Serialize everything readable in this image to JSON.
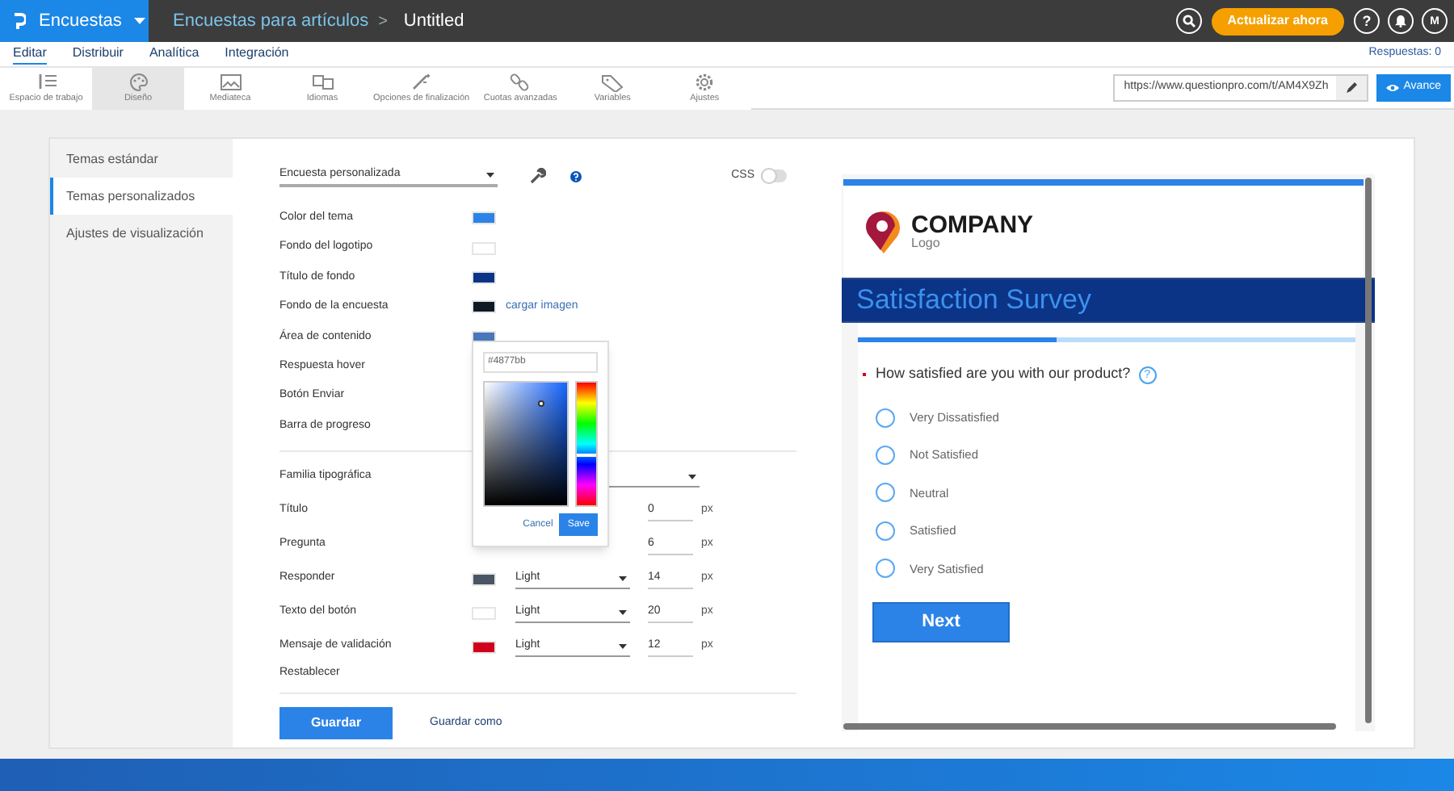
{
  "top_bar": {
    "app_menu": "Encuestas",
    "breadcrumb": {
      "parent": "Encuestas para artículos",
      "separator": ">",
      "current": "Untitled"
    },
    "upgrade_button": "Actualizar ahora",
    "help": "?",
    "avatar": "M"
  },
  "nav_tabs": [
    {
      "label": "Editar",
      "selected": true
    },
    {
      "label": "Distribuir",
      "selected": false
    },
    {
      "label": "Analítica",
      "selected": false
    },
    {
      "label": "Integración",
      "selected": false
    }
  ],
  "responses": "Respuestas: 0",
  "toolbar": [
    {
      "label": "Espacio de trabajo",
      "kind": "workspace",
      "selected": false
    },
    {
      "label": "Diseño",
      "kind": "palette",
      "selected": true
    },
    {
      "label": "Mediateca",
      "kind": "image",
      "selected": false
    },
    {
      "label": "Idiomas",
      "kind": "languages",
      "selected": false
    },
    {
      "label": "Opciones de finalización",
      "kind": "wand",
      "selected": false
    },
    {
      "label": "Cuotas avanzadas",
      "kind": "link",
      "selected": false
    },
    {
      "label": "Variables",
      "kind": "tag",
      "selected": false
    },
    {
      "label": "Ajustes",
      "kind": "gear",
      "selected": false
    }
  ],
  "url_field": {
    "value": "https://www.questionpro.com/t/AM4X9Zh"
  },
  "preview_button": "Avance",
  "sidebar": [
    {
      "label": "Temas estándar",
      "selected": false
    },
    {
      "label": "Temas personalizados",
      "selected": true
    },
    {
      "label": "Ajustes de visualización",
      "selected": false
    }
  ],
  "theme_select": {
    "value": "Encuesta personalizada"
  },
  "css_toggle": {
    "label": "CSS",
    "on": false
  },
  "colors": [
    {
      "label": "Color del tema",
      "color": "#2b83e8"
    },
    {
      "label": "Fondo del logotipo",
      "color": "#ffffff"
    },
    {
      "label": "Título de fondo",
      "color": "#0b3386"
    },
    {
      "label": "Fondo de la encuesta",
      "color": "#0d1a26",
      "link": "cargar imagen"
    },
    {
      "label": "Área de contenido",
      "color": "#4877bb"
    },
    {
      "label": "Respuesta hover"
    },
    {
      "label": "Botón Enviar"
    },
    {
      "label": "Barra de progreso"
    }
  ],
  "font_family": {
    "label": "Familia tipográfica"
  },
  "fonts": [
    {
      "label": "Título",
      "size": "0",
      "unit": "px"
    },
    {
      "label": "Pregunta",
      "size": "6",
      "unit": "px"
    },
    {
      "label": "Responder",
      "color": "#4a5565",
      "weight": "Light",
      "size": "14",
      "unit": "px"
    },
    {
      "label": "Texto del botón",
      "color": "#ffffff",
      "weight": "Light",
      "size": "20",
      "unit": "px"
    },
    {
      "label": "Mensaje de validación",
      "color": "#d0021b",
      "weight": "Light",
      "size": "12",
      "unit": "px"
    }
  ],
  "reset_link": "Restablecer",
  "save_button": "Guardar",
  "save_as_link": "Guardar como",
  "color_picker": {
    "value": "#4877bb",
    "hue": {
      "level": 0.6
    },
    "cancel": "Cancel",
    "save": "Save"
  },
  "preview": {
    "company": "COMPANY",
    "logo_caption": "Logo",
    "title": "Satisfaction Survey",
    "progress": {
      "level": 0.4
    },
    "question": "How satisfied are you with our product?",
    "required": true,
    "help": "?",
    "options": [
      {
        "label": "Very Dissatisfied",
        "selected": false
      },
      {
        "label": "Not Satisfied",
        "selected": false
      },
      {
        "label": "Neutral",
        "selected": false
      },
      {
        "label": "Satisfied",
        "selected": false
      },
      {
        "label": "Very Satisfied",
        "selected": false
      }
    ],
    "next_button": "Next"
  }
}
